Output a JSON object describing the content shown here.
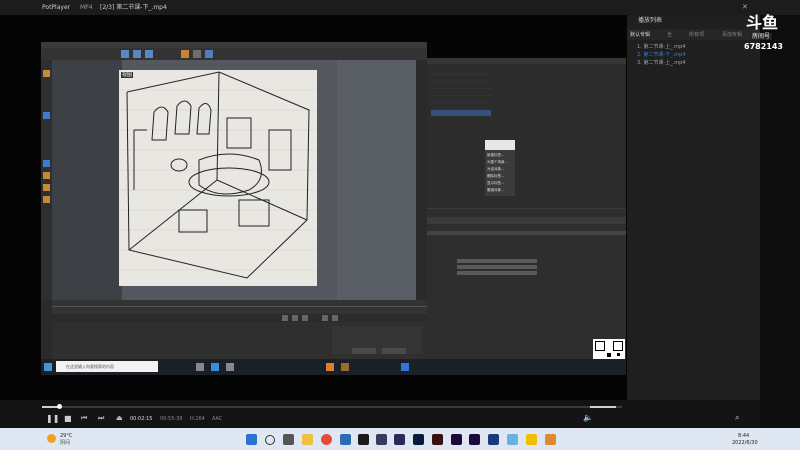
{
  "window": {
    "app_name": "PotPlayer",
    "format": "MP4",
    "file_title": "[2/3] 第二节课-下_.mp4"
  },
  "watermark": {
    "site_logo": "斗鱼",
    "sub": "房间号",
    "room_number": "6782143"
  },
  "playlist": {
    "header": "播放列表",
    "tabs": [
      "默认专辑",
      "全",
      "所有项",
      "添加专辑"
    ],
    "items": [
      {
        "label": "1. 第二节课-上_.mp4"
      },
      {
        "label": "2. 第二节课-下_.mp4",
        "active": true
      },
      {
        "label": "3. 第二节课-上_.mp4"
      }
    ]
  },
  "recording": {
    "context_menu": [
      "新建标签...",
      "为整个场景...",
      "为该对象...",
      "删除标签...",
      "显示标签...",
      "撤销对象..."
    ],
    "taskbar_search": "在这里输入你要搜索的内容",
    "viewport_tab": "视图"
  },
  "controls": {
    "time_current": "00:02:15",
    "time_total": "00:55:39",
    "track": "H.264",
    "audio": "AAC",
    "progress": 0.03,
    "volume": 0.85
  },
  "taskbar": {
    "temperature": "29°C",
    "weather": "阴间",
    "clock_time": "8:44",
    "clock_date": "2022/6/30"
  },
  "colors": {
    "accent_blue": "#3a6fd8",
    "playlist_active": "#3d7fd9",
    "progress_fill": "#cfcfcf"
  }
}
